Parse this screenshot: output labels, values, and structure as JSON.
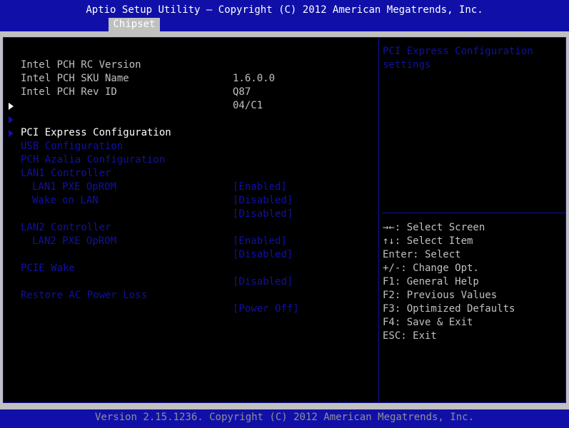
{
  "header": {
    "title": "Aptio Setup Utility – Copyright (C) 2012 American Megatrends, Inc.",
    "active_tab": "Chipset"
  },
  "info": [
    {
      "label": "Intel PCH RC Version",
      "value": "1.6.0.0"
    },
    {
      "label": "Intel PCH SKU Name",
      "value": "Q87"
    },
    {
      "label": "Intel PCH Rev ID",
      "value": "04/C1"
    }
  ],
  "submenus": [
    {
      "label": "PCI Express Configuration",
      "selected": true
    },
    {
      "label": "USB Configuration",
      "selected": false
    },
    {
      "label": "PCH Azalia Configuration",
      "selected": false
    }
  ],
  "options": {
    "lan1_controller": {
      "label": "LAN1 Controller",
      "value": "[Enabled]"
    },
    "lan1_pxe": {
      "label": "LAN1 PXE OpROM",
      "value": "[Disabled]"
    },
    "wake_on_lan": {
      "label": "Wake on LAN",
      "value": "[Disabled]"
    },
    "lan2_controller": {
      "label": "LAN2 Controller",
      "value": "[Enabled]"
    },
    "lan2_pxe": {
      "label": "LAN2 PXE OpROM",
      "value": "[Disabled]"
    },
    "pcie_wake": {
      "label": "PCIE Wake",
      "value": "[Disabled]"
    },
    "restore_ac": {
      "label": "Restore AC Power Loss",
      "value": "[Power Off]"
    }
  },
  "help": {
    "line1": "PCI Express Configuration",
    "line2": "settings"
  },
  "keys": [
    "→←: Select Screen",
    "↑↓: Select Item",
    "Enter: Select",
    "+/-: Change Opt.",
    "F1: General Help",
    "F2: Previous Values",
    "F3: Optimized Defaults",
    "F4: Save & Exit",
    "ESC: Exit"
  ],
  "footer": {
    "text": "Version 2.15.1236. Copyright (C) 2012 American Megatrends, Inc."
  },
  "colors": {
    "bios_blue": "#1010a8",
    "text_gray": "#c0c0c0",
    "selected_white": "#ffffff"
  }
}
